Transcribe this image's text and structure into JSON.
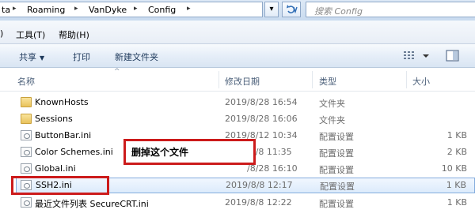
{
  "address": {
    "crumbs": [
      "ta",
      "Roaming",
      "VanDyke",
      "Config"
    ],
    "separator": "▸",
    "dropdown_glyph": "▾",
    "refresh_icon": "refresh-icon",
    "search_placeholder": "搜索 Config"
  },
  "menu": [
    "工具(T)",
    "帮助(H)"
  ],
  "menu_partial": ")",
  "commands": {
    "share": "共享",
    "print": "打印",
    "new_folder": "新建文件夹"
  },
  "columns": {
    "name": "名称",
    "date": "修改日期",
    "type": "类型",
    "size": "大小"
  },
  "files": [
    {
      "name": "KnownHosts",
      "date": "2019/8/28 16:54",
      "type": "文件夹",
      "size": "",
      "icon": "folder-icon"
    },
    {
      "name": "Sessions",
      "date": "2019/8/28 16:06",
      "type": "文件夹",
      "size": "",
      "icon": "folder-icon"
    },
    {
      "name": "ButtonBar.ini",
      "date": "2019/8/12 10:34",
      "type": "配置设置",
      "size": "1 KB",
      "icon": "ini-file-icon"
    },
    {
      "name": "Color Schemes.ini",
      "date": "/8/8 11:35",
      "type": "配置设置",
      "size": "2 KB",
      "icon": "ini-file-icon"
    },
    {
      "name": "Global.ini",
      "date": "/8/28 16:10",
      "type": "配置设置",
      "size": "10 KB",
      "icon": "ini-file-icon"
    },
    {
      "name": "SSH2.ini",
      "date": "2019/8/8 12:17",
      "type": "配置设置",
      "size": "1 KB",
      "icon": "ini-file-icon",
      "selected": true
    },
    {
      "name": "最近文件列表 SecureCRT.ini",
      "date": "2019/8/8 12:22",
      "type": "配置设置",
      "size": "1 KB",
      "icon": "ini-file-icon"
    }
  ],
  "annotation": {
    "text": "删掉这个文件",
    "color": "#cc1b1b"
  }
}
